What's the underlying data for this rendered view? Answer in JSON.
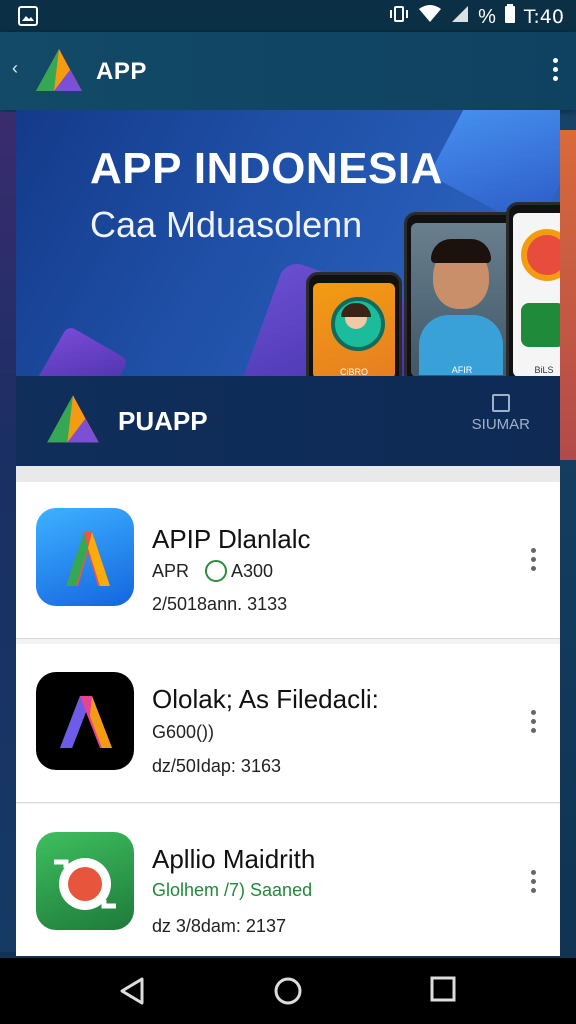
{
  "status_bar": {
    "time": "T:40",
    "battery": "%",
    "icons": [
      "image-icon",
      "vibrate-icon",
      "wifi-icon",
      "signal-icon",
      "battery-icon"
    ]
  },
  "app_bar": {
    "title": "APP",
    "back_icon": "chevron-left-icon",
    "menu_icon": "more-vert-icon"
  },
  "banner": {
    "headline": "APP INDONESIA",
    "subhead": "Caa Mduasolenn",
    "phone_labels": [
      "CiBRO",
      "AFIR",
      "BiLS"
    ]
  },
  "promo": {
    "title": "PUAPP",
    "save_label": "SIUMAR"
  },
  "apps": [
    {
      "name": "APIP Dlanlalc",
      "category": "APR",
      "badge": "A300",
      "size": "2/5018ann. 3133",
      "icon": "a-logo-icon"
    },
    {
      "name": "Ololak; As Filedacli:",
      "category": "G600())",
      "badge": "",
      "size": "ǳ/50Idap: 3163",
      "icon": "a-dark-logo-icon"
    },
    {
      "name": "Apllio Maidrith",
      "category": "Glolhem /7) Saaned",
      "badge": "",
      "size": "ǳ 3/8dam: 2137",
      "icon": "camera-logo-icon"
    }
  ],
  "nav_bar": {
    "back_icon": "triangle-back-icon",
    "home_icon": "circle-home-icon",
    "recents_icon": "square-recents-icon"
  },
  "colors": {
    "app_bar": "#124a68",
    "promo": "#0f2e5a",
    "accent_green": "#1f8a3a"
  }
}
